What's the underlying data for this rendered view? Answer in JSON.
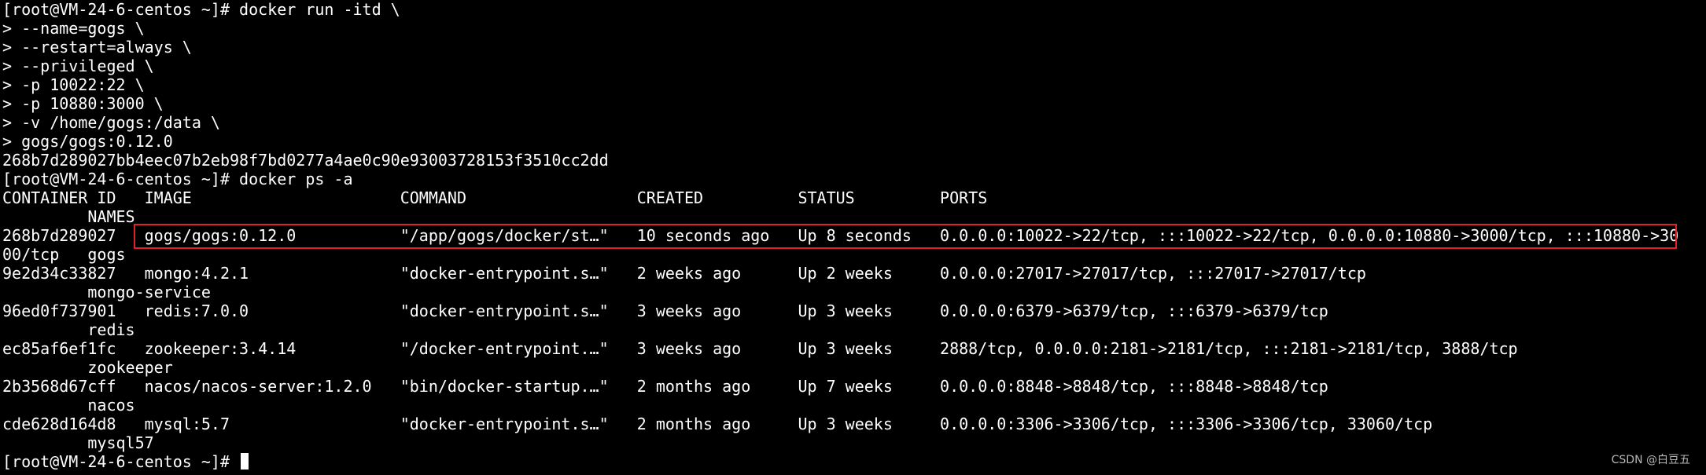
{
  "terminal": {
    "lines": [
      "[root@VM-24-6-centos ~]# docker run -itd \\",
      "> --name=gogs \\",
      "> --restart=always \\",
      "> --privileged \\",
      "> -p 10022:22 \\",
      "> -p 10880:3000 \\",
      "> -v /home/gogs:/data \\",
      "> gogs/gogs:0.12.0",
      "268b7d289027bb4eec07b2eb98f7bd0277a4ae0c90e93003728153f3510cc2dd",
      "[root@VM-24-6-centos ~]# docker ps -a",
      "CONTAINER ID   IMAGE                      COMMAND                  CREATED          STATUS         PORTS",
      "         NAMES",
      "268b7d289027   gogs/gogs:0.12.0           \"/app/gogs/docker/st…\"   10 seconds ago   Up 8 seconds   0.0.0.0:10022->22/tcp, :::10022->22/tcp, 0.0.0.0:10880->3000/tcp, :::10880->30",
      "00/tcp   gogs",
      "9e2d34c33827   mongo:4.2.1                \"docker-entrypoint.s…\"   2 weeks ago      Up 2 weeks     0.0.0.0:27017->27017/tcp, :::27017->27017/tcp",
      "         mongo-service",
      "96ed0f737901   redis:7.0.0                \"docker-entrypoint.s…\"   3 weeks ago      Up 3 weeks     0.0.0.0:6379->6379/tcp, :::6379->6379/tcp",
      "         redis",
      "ec85af6ef1fc   zookeeper:3.4.14           \"/docker-entrypoint.…\"   3 weeks ago      Up 3 weeks     2888/tcp, 0.0.0.0:2181->2181/tcp, :::2181->2181/tcp, 3888/tcp",
      "         zookeeper",
      "2b3568d67cff   nacos/nacos-server:1.2.0   \"bin/docker-startup.…\"   2 months ago     Up 7 weeks     0.0.0.0:8848->8848/tcp, :::8848->8848/tcp",
      "         nacos",
      "cde628d164d8   mysql:5.7                  \"docker-entrypoint.s…\"   2 months ago     Up 3 weeks     0.0.0.0:3306->3306/tcp, :::3306->3306/tcp, 33060/tcp",
      "         mysql57",
      "[root@VM-24-6-centos ~]# "
    ]
  },
  "watermark": "CSDN @白豆五",
  "colors": {
    "background": "#000000",
    "text": "#ffffff",
    "highlight_border": "#e0202a"
  }
}
